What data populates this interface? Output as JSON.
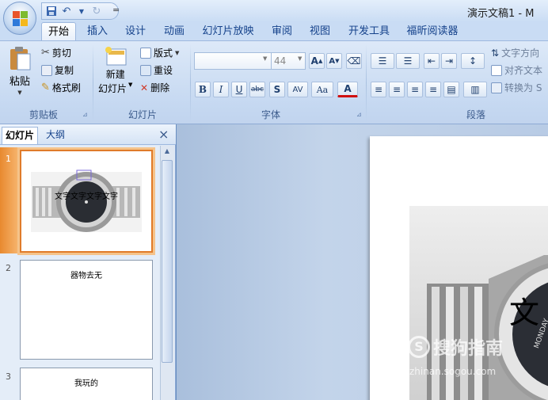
{
  "window": {
    "title": "演示文稿1 - M"
  },
  "quick_access": {
    "save_icon": "save-icon",
    "undo_icon": "undo-icon",
    "redo_icon": "redo-icon",
    "more": "="
  },
  "tabs": [
    "开始",
    "插入",
    "设计",
    "动画",
    "幻灯片放映",
    "审阅",
    "视图",
    "开发工具",
    "福昕阅读器"
  ],
  "ribbon": {
    "clipboard": {
      "label": "剪贴板",
      "paste": "粘贴",
      "cut": "剪切",
      "copy": "复制",
      "format_painter": "格式刷"
    },
    "slides": {
      "label": "幻灯片",
      "new_slide_1": "新建",
      "new_slide_2": "幻灯片",
      "layout": "版式",
      "reset": "重设",
      "delete": "删除"
    },
    "font": {
      "label": "字体",
      "font_name": "",
      "font_size": "44",
      "bold": "B",
      "italic": "I",
      "underline": "U",
      "strike": "abc",
      "shadow": "S",
      "spacing": "AV",
      "case": "Aa",
      "color": "A"
    },
    "paragraph": {
      "label": "段落",
      "text_direction": "文字方向",
      "align_text": "对齐文本",
      "convert": "转换为 S"
    }
  },
  "pane": {
    "tab_slides": "幻灯片",
    "tab_outline": "大纲",
    "close": "×"
  },
  "slides": [
    {
      "num": "1",
      "text": "文字文字文字文字"
    },
    {
      "num": "2",
      "text": "器物去无"
    },
    {
      "num": "3",
      "text": "我玩的"
    }
  ],
  "main_slide": {
    "title_glyph": "文",
    "watermark": "搜狗指南",
    "watermark_url": "zhinan.sogou.com",
    "bezel_text": "MONDAY"
  },
  "colors": {
    "accent": "#e07b2a",
    "ribbon": "#c9dcf4",
    "text": "#15428b"
  }
}
